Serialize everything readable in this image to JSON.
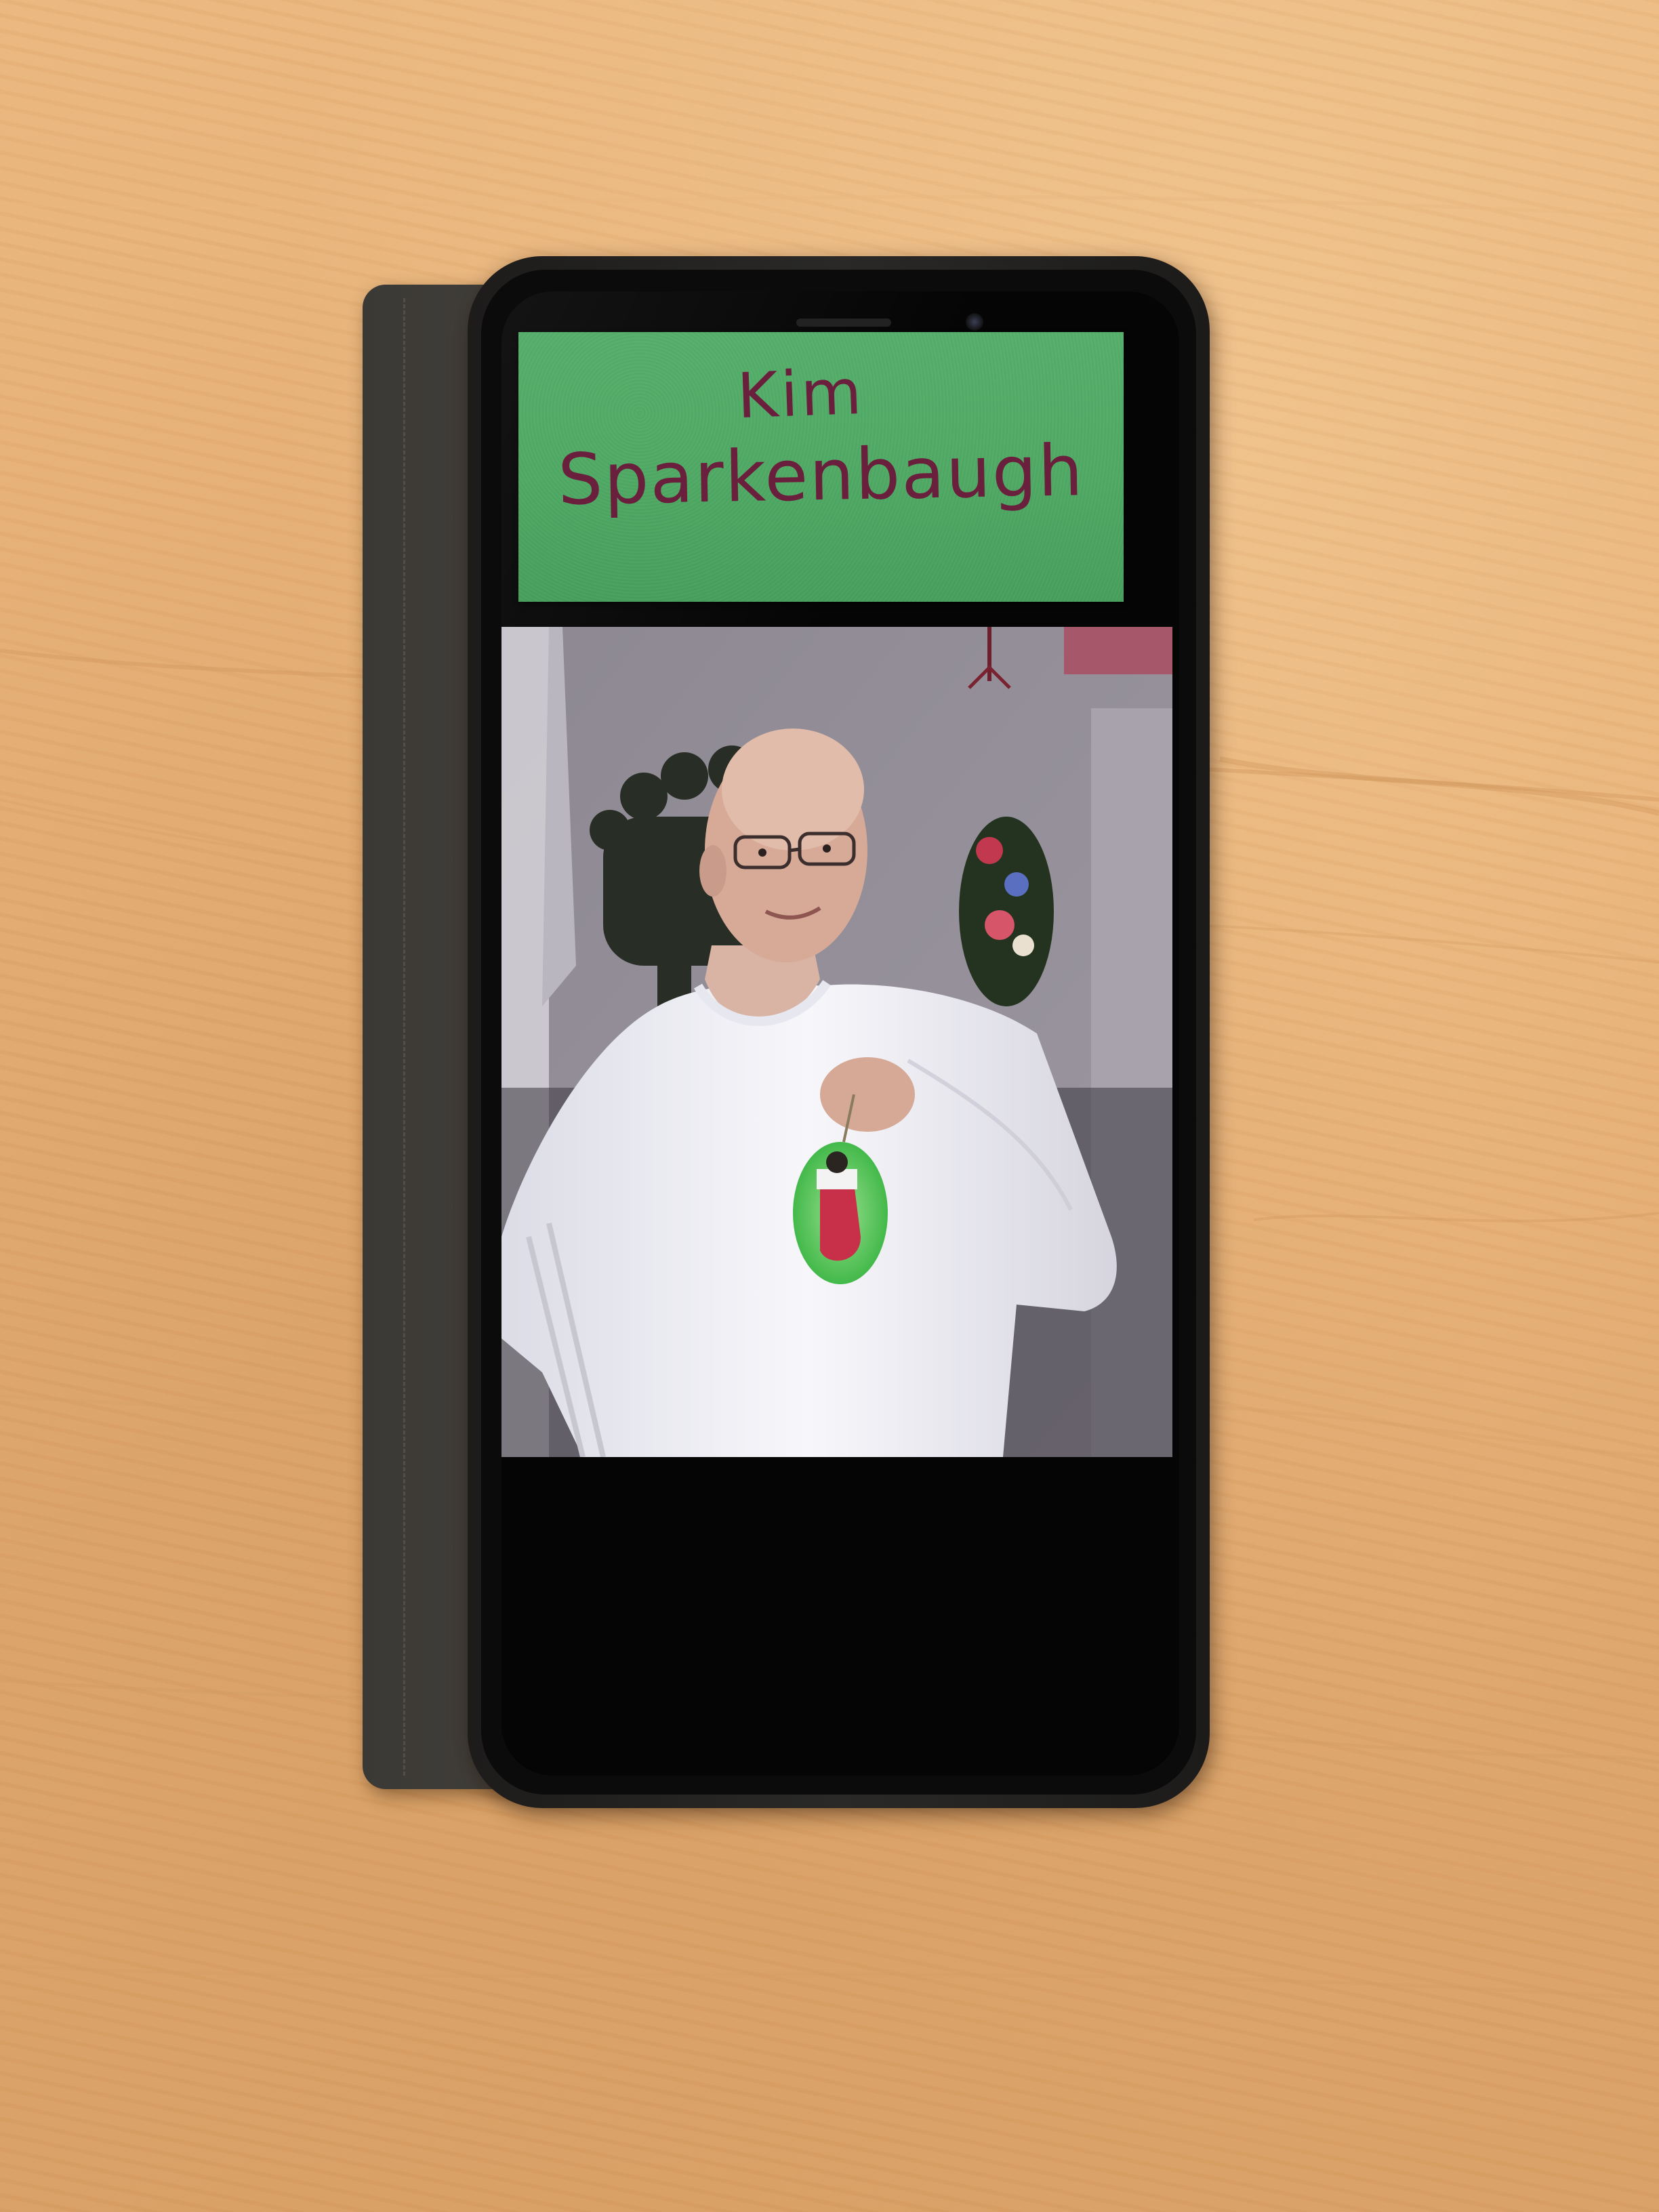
{
  "scene": {
    "surface": "wooden-table",
    "device": "smartphone-in-wallet-case"
  },
  "name_tag": {
    "first_name": "Kim",
    "last_name": "Sparkenbaugh",
    "color": "#52ac67",
    "ink_color": "#6a1f3d"
  },
  "photo": {
    "subject": "man-holding-ornament",
    "ornament_color": "#5fcf5a",
    "shirt_color": "#f2f1f5"
  }
}
